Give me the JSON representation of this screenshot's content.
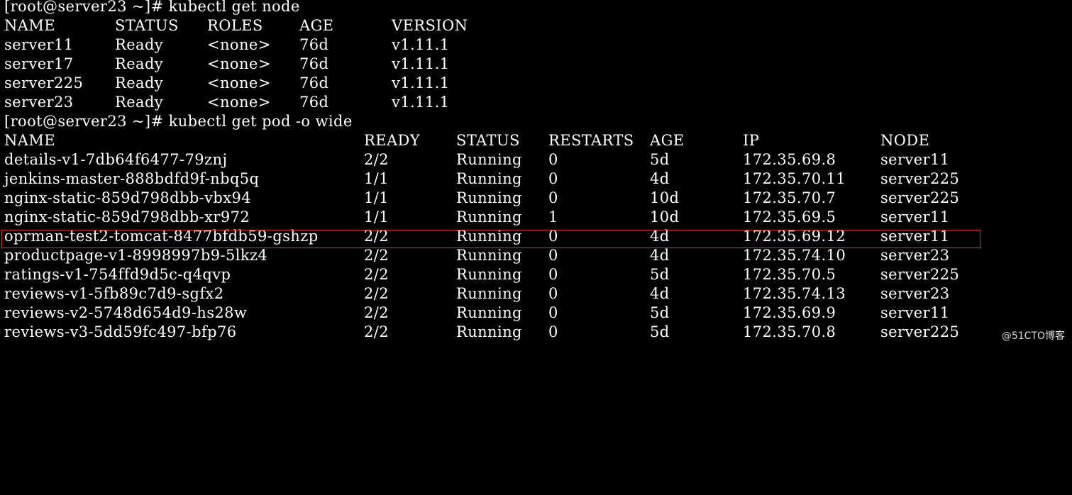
{
  "terminal": {
    "prev_fragment": "      ",
    "cmd1": {
      "prompt": "[root@server23 ~]# ",
      "command": "kubectl get node"
    },
    "nodes": {
      "headers": [
        "NAME",
        "STATUS",
        "ROLES",
        "AGE",
        "VERSION"
      ],
      "rows": [
        [
          "server11",
          "Ready",
          "<none>",
          "76d",
          "v1.11.1"
        ],
        [
          "server17",
          "Ready",
          "<none>",
          "76d",
          "v1.11.1"
        ],
        [
          "server225",
          "Ready",
          "<none>",
          "76d",
          "v1.11.1"
        ],
        [
          "server23",
          "Ready",
          "<none>",
          "76d",
          "v1.11.1"
        ]
      ]
    },
    "cmd2": {
      "prompt": "[root@server23 ~]# ",
      "command": "kubectl get pod -o wide"
    },
    "pods": {
      "headers": [
        "NAME",
        "READY",
        "STATUS",
        "RESTARTS",
        "AGE",
        "IP",
        "NODE"
      ],
      "rows": [
        [
          "details-v1-7db64f6477-79znj",
          "2/2",
          "Running",
          "0",
          "5d",
          "172.35.69.8",
          "server11"
        ],
        [
          "jenkins-master-888bdfd9f-nbq5q",
          "1/1",
          "Running",
          "0",
          "4d",
          "172.35.70.11",
          "server225"
        ],
        [
          "nginx-static-859d798dbb-vbx94",
          "1/1",
          "Running",
          "0",
          "10d",
          "172.35.70.7",
          "server225"
        ],
        [
          "nginx-static-859d798dbb-xr972",
          "1/1",
          "Running",
          "1",
          "10d",
          "172.35.69.5",
          "server11"
        ],
        [
          "oprman-test2-tomcat-8477bfdb59-gshzp",
          "2/2",
          "Running",
          "0",
          "4d",
          "172.35.69.12",
          "server11"
        ],
        [
          "productpage-v1-8998997b9-5lkz4",
          "2/2",
          "Running",
          "0",
          "4d",
          "172.35.74.10",
          "server23"
        ],
        [
          "ratings-v1-754ffd9d5c-q4qvp",
          "2/2",
          "Running",
          "0",
          "5d",
          "172.35.70.5",
          "server225"
        ],
        [
          "reviews-v1-5fb89c7d9-sgfx2",
          "2/2",
          "Running",
          "0",
          "4d",
          "172.35.74.13",
          "server23"
        ],
        [
          "reviews-v2-5748d654d9-hs28w",
          "2/2",
          "Running",
          "0",
          "5d",
          "172.35.69.9",
          "server11"
        ],
        [
          "reviews-v3-5dd59fc497-bfp76",
          "2/2",
          "Running",
          "0",
          "5d",
          "172.35.70.8",
          "server225"
        ]
      ],
      "highlighted_row": 4,
      "highlight_color": "#d9302c"
    }
  },
  "watermark": "@51CTO博客",
  "colors": {
    "background": "#000000",
    "text": "#ffffff"
  }
}
